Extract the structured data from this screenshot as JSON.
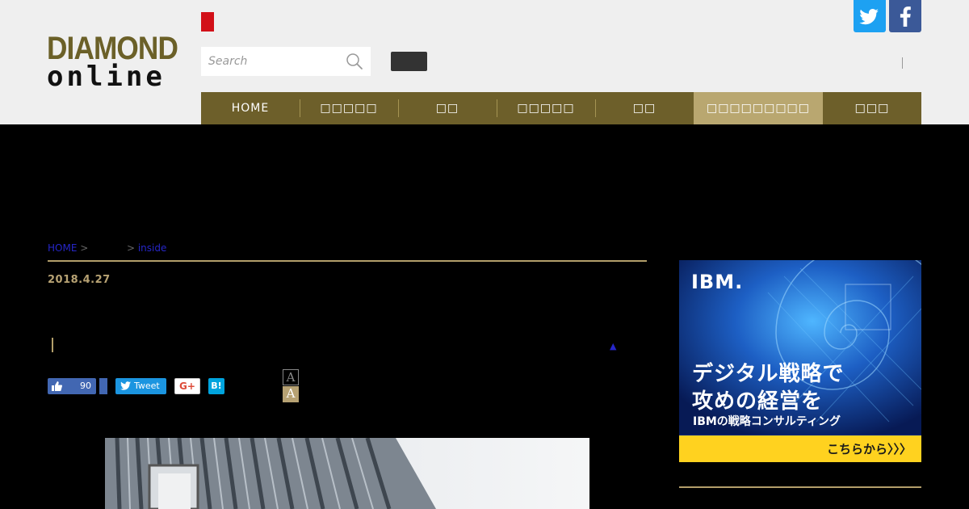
{
  "header": {
    "logo_top": "DIAMOND",
    "logo_bottom": "online",
    "search_placeholder": "Search"
  },
  "nav": {
    "items": [
      {
        "label": "HOME",
        "active": false
      },
      {
        "label": "□□□□□",
        "active": false
      },
      {
        "label": "□□",
        "active": false
      },
      {
        "label": "□□□□□",
        "active": false
      },
      {
        "label": "□□",
        "active": false
      },
      {
        "label": "□□□□□□□□□",
        "active": true
      },
      {
        "label": "□□□",
        "active": false
      }
    ]
  },
  "breadcrumb": {
    "home": "HOME",
    "sep1": ">",
    "sep2": ">",
    "current": "inside"
  },
  "article": {
    "date": "2018.4.27"
  },
  "share": {
    "like_count": "90",
    "tweet_label": "Tweet",
    "gplus_label": "G+",
    "hatena_label": "B!",
    "font_small": "A",
    "font_large": "A"
  },
  "ad": {
    "logo": "IBM.",
    "headline_line1": "デジタル戦略で",
    "headline_line2": "攻めの経営を",
    "subline": "IBMの戦略コンサルティング",
    "cta": "こちらから〉〉〉"
  },
  "colors": {
    "nav_bg": "#6d5f2a",
    "nav_active": "#b9a770",
    "gold_accent": "#b29e6a",
    "red_tab": "#d21018",
    "twitter": "#1da1f2",
    "facebook": "#3b5998",
    "ad_cta": "#ffd21f"
  }
}
